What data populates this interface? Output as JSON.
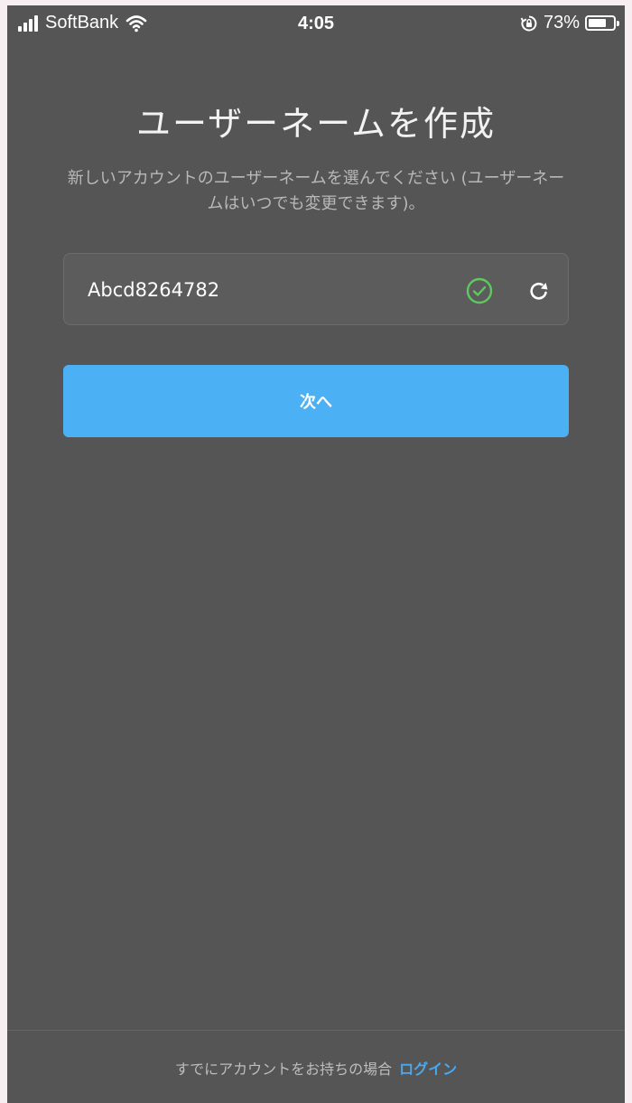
{
  "status_bar": {
    "carrier": "SoftBank",
    "time": "4:05",
    "battery_percent": "73%",
    "battery_level": 0.73,
    "icons": [
      "signal-icon",
      "wifi-icon",
      "rotation-lock-icon",
      "battery-icon"
    ]
  },
  "main": {
    "title": "ユーザーネームを作成",
    "subtitle": "新しいアカウントのユーザーネームを選んでください (ユーザーネームはいつでも変更できます)。",
    "username": {
      "value": "Abcd8264782",
      "valid_icon": "check-circle-icon",
      "refresh_icon": "refresh-icon"
    },
    "next_button_label": "次へ"
  },
  "footer": {
    "prompt": "すでにアカウントをお持ちの場合",
    "login_label": "ログイン"
  },
  "colors": {
    "background": "#555555",
    "accent": "#4cb1f4",
    "valid": "#5fc95f",
    "link": "#4aa8ef"
  }
}
